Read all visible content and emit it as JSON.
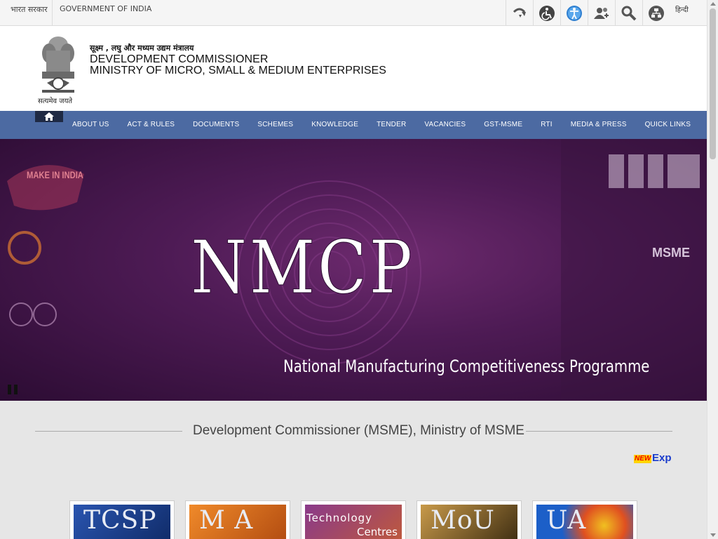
{
  "topbar": {
    "gov_hindi": "भारत सरकार",
    "gov_english": "GOVERNMENT OF INDIA",
    "tools": [
      {
        "icon": "skip-to-content-icon"
      },
      {
        "icon": "accessibility-icon"
      },
      {
        "icon": "screen-reader-icon"
      },
      {
        "icon": "social-users-icon"
      },
      {
        "icon": "search-icon"
      },
      {
        "icon": "sitemap-icon"
      }
    ],
    "language_toggle": "हिन्दी"
  },
  "header": {
    "title_hindi": "सूक्ष्म , लघु और मध्यम उद्यम मंत्रालय",
    "title_line1": "DEVELOPMENT COMMISSIONER",
    "title_line2": "MINISTRY OF MICRO, SMALL & MEDIUM ENTERPRISES",
    "emblem_motto": "सत्यमेव जयते"
  },
  "nav": {
    "home_icon": "home-icon",
    "items": [
      {
        "label": "ABOUT US"
      },
      {
        "label": "ACT & RULES"
      },
      {
        "label": "DOCUMENTS"
      },
      {
        "label": "SCHEMES"
      },
      {
        "label": "KNOWLEDGE"
      },
      {
        "label": "TENDER"
      },
      {
        "label": "VACANCIES"
      },
      {
        "label": "GST-MSME"
      },
      {
        "label": "RTI"
      },
      {
        "label": "MEDIA & PRESS"
      },
      {
        "label": "QUICK LINKS"
      }
    ]
  },
  "banner": {
    "title": "NMCP",
    "subtitle": "National Manufacturing Competitiveness Programme",
    "logo_left": "MAKE IN INDIA",
    "logo_right": "MSME"
  },
  "content": {
    "section_title": "Development Commissioner (MSME), Ministry of MSME",
    "new_badge": "NEW",
    "ticker_text": "Exp",
    "tiles": [
      {
        "label": "TCSP",
        "color": "#1b3f8f"
      },
      {
        "label": "M A",
        "color": "#d4641c"
      },
      {
        "label": "Technology",
        "label2": "Centres",
        "color": "#6a2a6a"
      },
      {
        "label": "MoU",
        "color": "#8a6a2a"
      },
      {
        "label": "UA",
        "color": "#1c5fc8"
      }
    ]
  },
  "colors": {
    "nav_bg": "#4c6aa2",
    "banner_bg": "#4e1b55",
    "content_bg": "#e6e6e6"
  }
}
